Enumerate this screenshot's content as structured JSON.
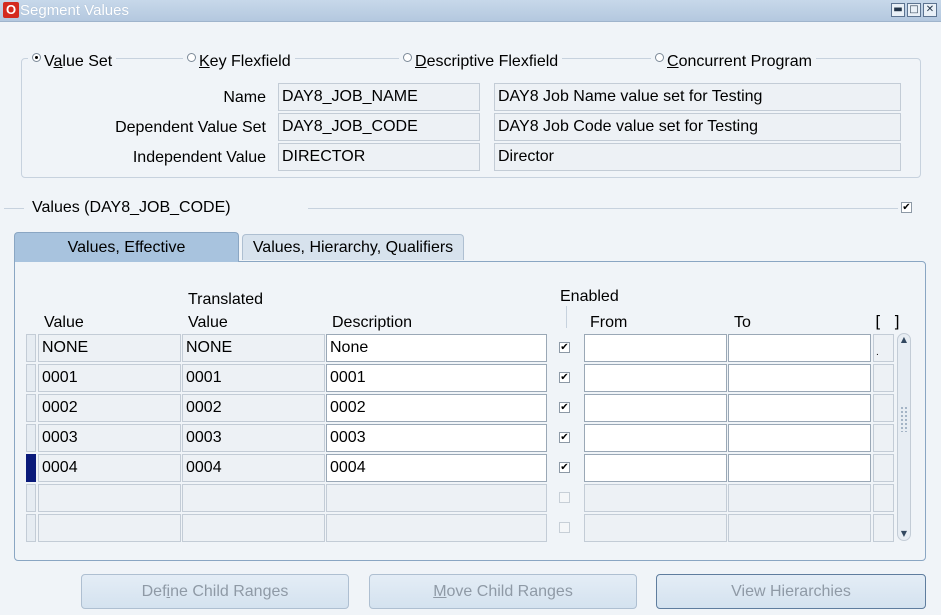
{
  "window": {
    "title": "Segment Values",
    "logo_letter": "O",
    "controls": {
      "minimize": "▬",
      "maximize": "□",
      "close": "✕"
    }
  },
  "source": {
    "options": [
      {
        "label_pre": "",
        "label_u": "",
        "label_post": "",
        "full": "Value Set",
        "selected": true
      },
      {
        "full": "Key Flexfield",
        "selected": false
      },
      {
        "full": "Descriptive Flexfield",
        "selected": false
      },
      {
        "full": "Concurrent Program",
        "selected": false
      }
    ],
    "value_set_pre": "V",
    "value_set_u": "a",
    "value_set_post": "lue Set",
    "key_u": "K",
    "key_post": "ey Flexfield",
    "desc_u": "D",
    "desc_post": "escriptive Flexfield",
    "conc_u": "C",
    "conc_post": "oncurrent Program"
  },
  "fields": {
    "name_label": "Name",
    "name_value": "DAY8_JOB_NAME",
    "name_desc": "DAY8 Job Name value set for Testing",
    "dep_label": "Dependent Value Set",
    "dep_value": "DAY8_JOB_CODE",
    "dep_desc": "DAY8 Job Code value set for Testing",
    "indep_label": "Independent Value",
    "indep_value": "DIRECTOR",
    "indep_desc": "Director"
  },
  "values_section": {
    "title": "Values (DAY8_JOB_CODE)",
    "checkbox_checked": true
  },
  "tabs": [
    {
      "label": "Values, Effective",
      "active": true
    },
    {
      "label": "Values, Hierarchy, Qualifiers",
      "active": false
    }
  ],
  "table": {
    "headers": {
      "value": "Value",
      "translated_top": "Translated",
      "translated_bottom": "Value",
      "description": "Description",
      "enabled": "Enabled",
      "from": "From",
      "to": "To",
      "extra": "[ ]"
    },
    "rows": [
      {
        "value": "NONE",
        "translated": "NONE",
        "description": "None",
        "enabled": true,
        "from": "",
        "to": "",
        "extra": "."
      },
      {
        "value": "0001",
        "translated": "0001",
        "description": "0001",
        "enabled": true,
        "from": "",
        "to": "",
        "extra": ""
      },
      {
        "value": "0002",
        "translated": "0002",
        "description": "0002",
        "enabled": true,
        "from": "",
        "to": "",
        "extra": ""
      },
      {
        "value": "0003",
        "translated": "0003",
        "description": "0003",
        "enabled": true,
        "from": "",
        "to": "",
        "extra": ""
      },
      {
        "value": "0004",
        "translated": "0004",
        "description": "0004",
        "enabled": true,
        "from": "",
        "to": "",
        "extra": ""
      },
      {
        "value": "",
        "translated": "",
        "description": "",
        "enabled": false,
        "from": "",
        "to": "",
        "extra": ""
      },
      {
        "value": "",
        "translated": "",
        "description": "",
        "enabled": false,
        "from": "",
        "to": "",
        "extra": ""
      }
    ],
    "current_row": 4,
    "check_glyph": "✔",
    "scroll_up": "▲",
    "scroll_down": "▼"
  },
  "buttons": {
    "define_pre": "Def",
    "define_u": "i",
    "define_post": "ne Child Ranges",
    "move_u": "M",
    "move_post": "ove Child Ranges",
    "view_label": "View Hierarchies"
  }
}
